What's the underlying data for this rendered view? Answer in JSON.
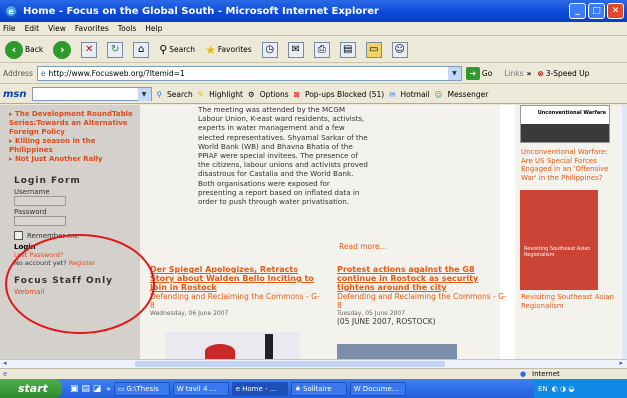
{
  "window": {
    "title": "Home - Focus on the Global South - Microsoft Internet Explorer",
    "buttons": [
      "_",
      "□",
      "✕"
    ]
  },
  "menu": [
    "File",
    "Edit",
    "View",
    "Favorites",
    "Tools",
    "Help"
  ],
  "toolbar": {
    "back": "Back",
    "search": "Search",
    "favorites": "Favorites"
  },
  "address": {
    "label": "Address",
    "url": "http://www.Focusweb.org/?Itemid=1",
    "go": "Go",
    "links": "Links",
    "extra": "3-Speed Up"
  },
  "msn": {
    "logo": "msn",
    "search": "Search",
    "highlight": "Highlight",
    "options": "Options",
    "popups": "Pop-ups Blocked (51)",
    "hotmail": "Hotmail",
    "messenger": "Messenger"
  },
  "left": {
    "links": [
      "The Development RoundTable Series:Towards an Alternative Foreign Policy",
      "Killing season in the Philippines",
      "Not Just Another Rally"
    ],
    "login_title": "Login Form",
    "username_label": "Username",
    "password_label": "Password",
    "remember": "Remember me",
    "login_btn": "Login",
    "lost_password": "Lost Password?",
    "no_account": "No account yet?",
    "register": "Register",
    "staff_title": "Focus Staff Only",
    "webmail": "Webmail"
  },
  "article": {
    "text": "The meeting was attended by the MCGM Labour Union, K-east ward residents, activists, experts in water management and a few elected representatives. Shyamal Sarkar of the World Bank (WB) and Bhavna Bhatia of the PPIAF were special invitees. The presence of the citizens, labour unions and activists proved disastrous for Castalia and the World Bank. Both organisations were exposed for presenting a report based on inflated data in order to push through water privatisation.",
    "read_more": "Read more..."
  },
  "stories": [
    {
      "headline": "Der Spiegel Apologizes, Retracts Story about Walden Bello Inciting to Join in Rostock",
      "section": "Defending and Reclaiming the Commons - G-8",
      "date": "Wednesday, 06 June 2007",
      "dateline": ""
    },
    {
      "headline": "Protest actions against the G8 continue in Rostock as security tightens around the city",
      "section": "Defending and Reclaiming the Commons - G-8",
      "date": "Tuesday, 05 June 2007",
      "dateline": "(05 JUNE 2007, ROSTOCK)"
    }
  ],
  "right": {
    "top_caption": "Unconventional Warfare",
    "link1": "Unconventional Warfare: Are US Special Forces Engaged in an 'Offensive War' in the Philippines?",
    "book_title": "Revisiting Southeast Asian Regionalism",
    "link2": "Revisiting Southeast Asian Regionalism"
  },
  "status": {
    "zone": "Internet"
  },
  "taskbar": {
    "start": "start",
    "tasks": [
      "G:\\Thesis",
      "tavil 4 ...",
      "Home - ...",
      "Solitaire",
      "Docume..."
    ],
    "lang": "EN"
  }
}
